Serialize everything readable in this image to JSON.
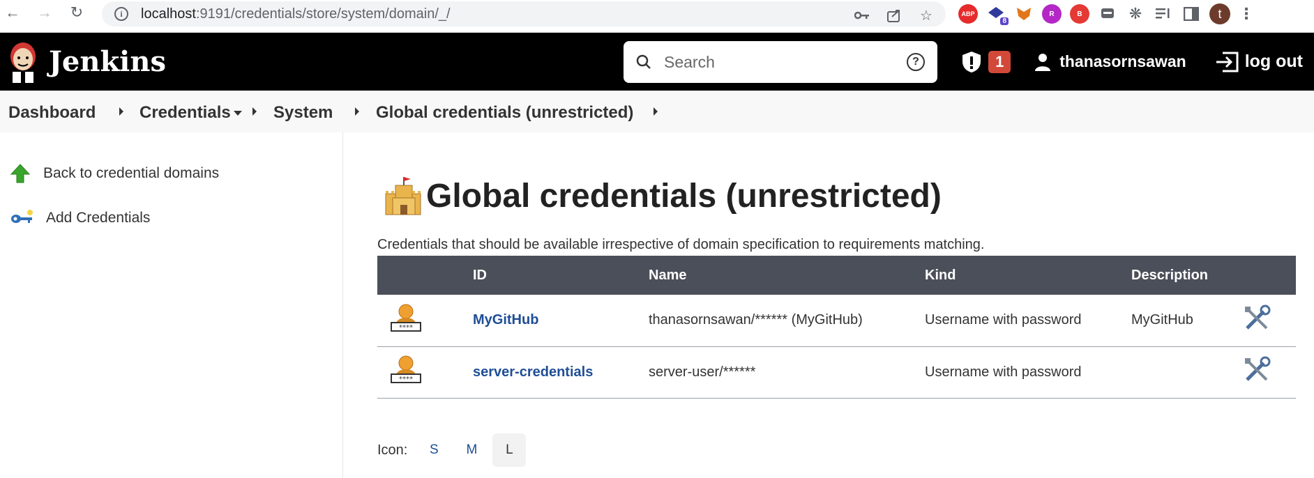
{
  "browser": {
    "url_host": "localhost",
    "url_rest": ":9191/credentials/store/system/domain/_/",
    "ext_badge": "8",
    "profile_initial": "t"
  },
  "header": {
    "brand": "Jenkins",
    "search_placeholder": "Search",
    "help_glyph": "?",
    "security_count": "1",
    "username": "thanasornsawan",
    "logout": "log out"
  },
  "breadcrumb": {
    "items": [
      "Dashboard",
      "Credentials",
      "System",
      "Global credentials (unrestricted)"
    ]
  },
  "sidebar": {
    "items": [
      {
        "label": "Back to credential domains",
        "icon": "up-arrow-icon"
      },
      {
        "label": "Add Credentials",
        "icon": "key-icon"
      }
    ]
  },
  "main": {
    "title": "Global credentials (unrestricted)",
    "description": "Credentials that should be available irrespective of domain specification to requirements matching.",
    "columns": [
      "",
      "ID",
      "Name",
      "Kind",
      "Description",
      ""
    ],
    "rows": [
      {
        "id": "MyGitHub",
        "name": "thanasornsawan/****** (MyGitHub)",
        "kind": "Username with password",
        "description": "MyGitHub"
      },
      {
        "id": "server-credentials",
        "name": "server-user/******",
        "kind": "Username with password",
        "description": ""
      }
    ],
    "icon_label": "Icon:",
    "icon_sizes": [
      "S",
      "M",
      "L"
    ],
    "icon_size_selected": "L"
  },
  "colors": {
    "header_bg": "#000000",
    "table_header_bg": "#4a4f59",
    "link": "#1f4e96",
    "badge": "#d24939"
  }
}
